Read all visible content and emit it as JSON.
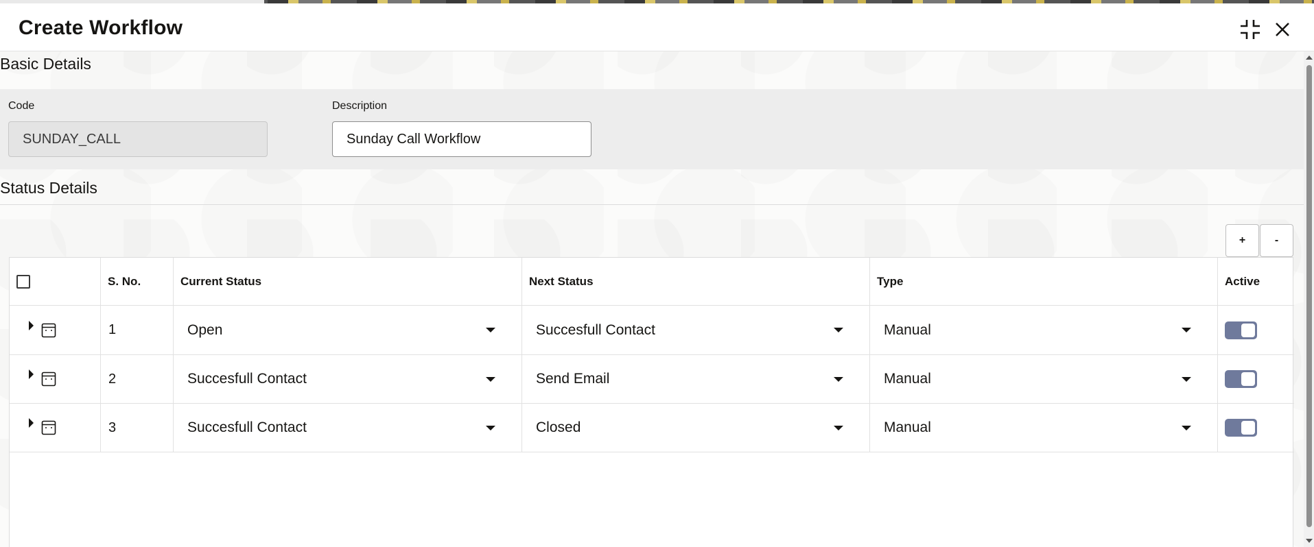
{
  "dialog": {
    "title": "Create Workflow"
  },
  "basic_details": {
    "heading": "Basic Details",
    "code_label": "Code",
    "code_value": "SUNDAY_CALL",
    "description_label": "Description",
    "description_value": "Sunday Call Workflow"
  },
  "status_details": {
    "heading": "Status Details",
    "add_label": "+",
    "remove_label": "-",
    "columns": {
      "sno": "S. No.",
      "current_status": "Current Status",
      "next_status": "Next Status",
      "type": "Type",
      "active": "Active"
    },
    "rows": [
      {
        "sno": "1",
        "current_status": "Open",
        "next_status": "Succesfull Contact",
        "type": "Manual",
        "active": true
      },
      {
        "sno": "2",
        "current_status": "Succesfull Contact",
        "next_status": "Send Email",
        "type": "Manual",
        "active": true
      },
      {
        "sno": "3",
        "current_status": "Succesfull Contact",
        "next_status": "Closed",
        "type": "Manual",
        "active": true
      }
    ]
  },
  "colors": {
    "toggle_on": "#6f7a9c",
    "panel_bg": "#ededed"
  },
  "icons": {
    "minimize": "collapse-icon",
    "close": "close-icon",
    "row_expand": "triangle-right-icon",
    "row_detail": "record-icon"
  }
}
